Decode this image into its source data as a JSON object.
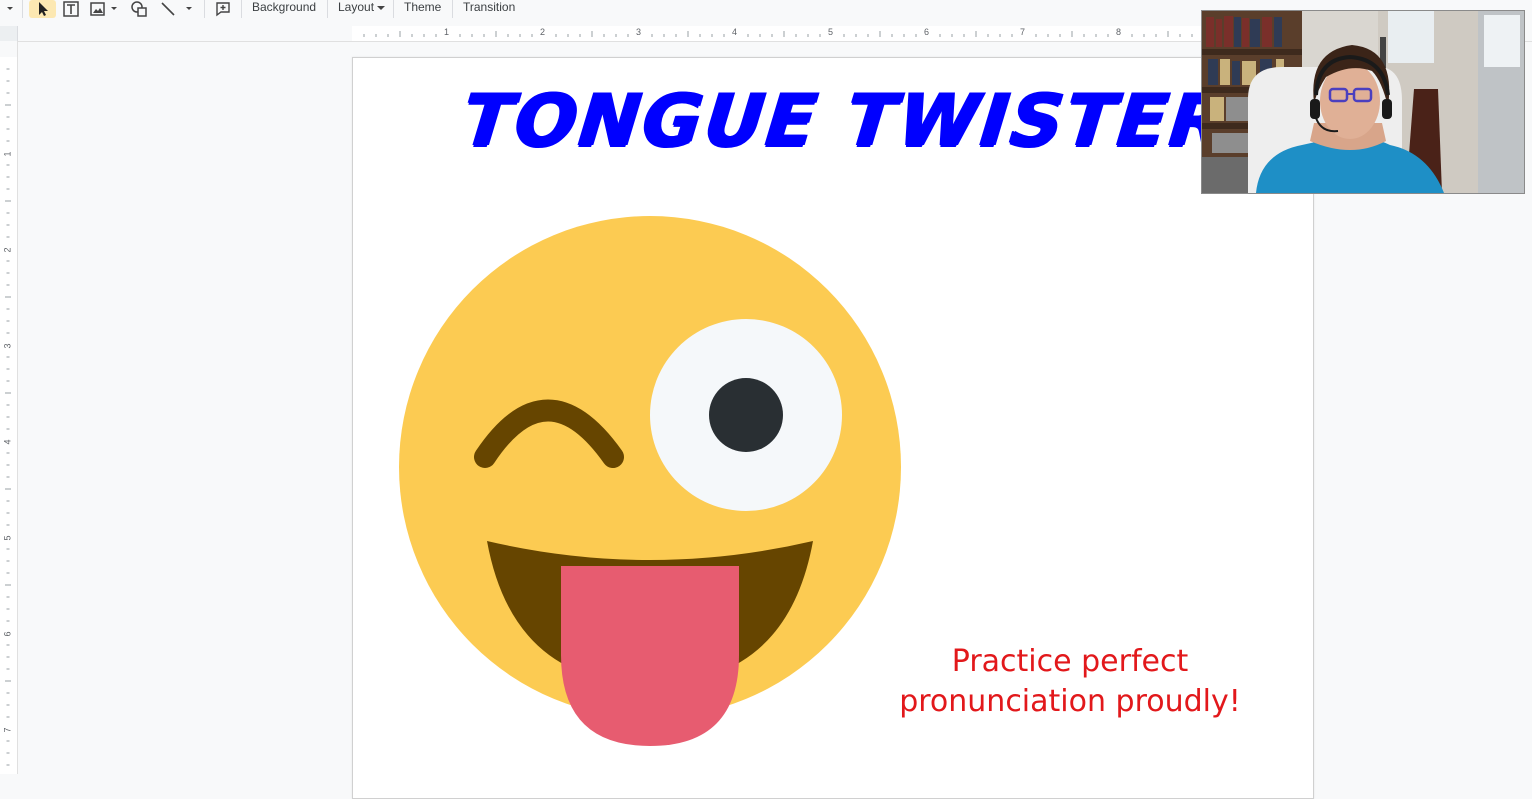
{
  "toolbar": {
    "background_label": "Background",
    "layout_label": "Layout",
    "theme_label": "Theme",
    "transition_label": "Transition"
  },
  "ruler": {
    "horizontal_ticks": [
      "1",
      "2",
      "3",
      "4",
      "5",
      "6",
      "7",
      "8"
    ],
    "vertical_ticks": [
      "1",
      "2",
      "3",
      "4",
      "5",
      "6",
      "7"
    ]
  },
  "slide": {
    "title": "TONGUE TWISTERS",
    "caption_line1": "Practice perfect",
    "caption_line2": "pronunciation proudly!",
    "emoji": "winking-face-with-tongue"
  },
  "colors": {
    "title": "#0000ff",
    "caption": "#e2181b",
    "emoji_face": "#fccb52",
    "emoji_mouth": "#664500",
    "emoji_tongue": "#e75c70"
  }
}
